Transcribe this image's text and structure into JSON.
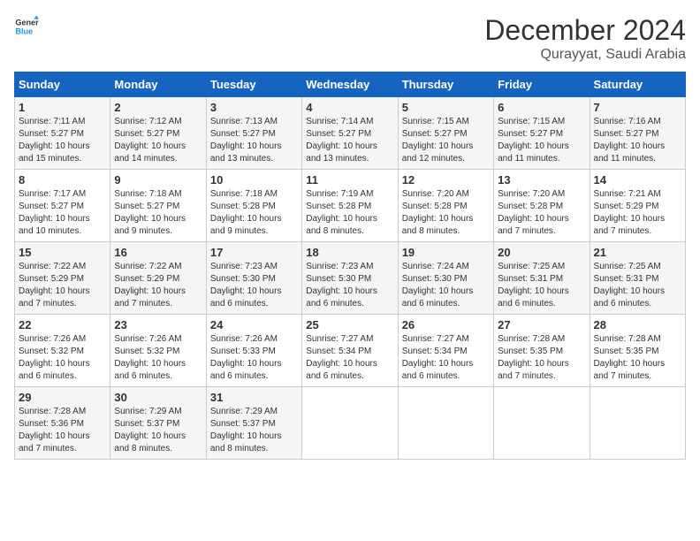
{
  "header": {
    "logo_line1": "General",
    "logo_line2": "Blue",
    "month": "December 2024",
    "location": "Qurayyat, Saudi Arabia"
  },
  "columns": [
    "Sunday",
    "Monday",
    "Tuesday",
    "Wednesday",
    "Thursday",
    "Friday",
    "Saturday"
  ],
  "weeks": [
    [
      {
        "day": "1",
        "sunrise": "7:11 AM",
        "sunset": "5:27 PM",
        "daylight": "10 hours and 15 minutes."
      },
      {
        "day": "2",
        "sunrise": "7:12 AM",
        "sunset": "5:27 PM",
        "daylight": "10 hours and 14 minutes."
      },
      {
        "day": "3",
        "sunrise": "7:13 AM",
        "sunset": "5:27 PM",
        "daylight": "10 hours and 13 minutes."
      },
      {
        "day": "4",
        "sunrise": "7:14 AM",
        "sunset": "5:27 PM",
        "daylight": "10 hours and 13 minutes."
      },
      {
        "day": "5",
        "sunrise": "7:15 AM",
        "sunset": "5:27 PM",
        "daylight": "10 hours and 12 minutes."
      },
      {
        "day": "6",
        "sunrise": "7:15 AM",
        "sunset": "5:27 PM",
        "daylight": "10 hours and 11 minutes."
      },
      {
        "day": "7",
        "sunrise": "7:16 AM",
        "sunset": "5:27 PM",
        "daylight": "10 hours and 11 minutes."
      }
    ],
    [
      {
        "day": "8",
        "sunrise": "7:17 AM",
        "sunset": "5:27 PM",
        "daylight": "10 hours and 10 minutes."
      },
      {
        "day": "9",
        "sunrise": "7:18 AM",
        "sunset": "5:27 PM",
        "daylight": "10 hours and 9 minutes."
      },
      {
        "day": "10",
        "sunrise": "7:18 AM",
        "sunset": "5:28 PM",
        "daylight": "10 hours and 9 minutes."
      },
      {
        "day": "11",
        "sunrise": "7:19 AM",
        "sunset": "5:28 PM",
        "daylight": "10 hours and 8 minutes."
      },
      {
        "day": "12",
        "sunrise": "7:20 AM",
        "sunset": "5:28 PM",
        "daylight": "10 hours and 8 minutes."
      },
      {
        "day": "13",
        "sunrise": "7:20 AM",
        "sunset": "5:28 PM",
        "daylight": "10 hours and 7 minutes."
      },
      {
        "day": "14",
        "sunrise": "7:21 AM",
        "sunset": "5:29 PM",
        "daylight": "10 hours and 7 minutes."
      }
    ],
    [
      {
        "day": "15",
        "sunrise": "7:22 AM",
        "sunset": "5:29 PM",
        "daylight": "10 hours and 7 minutes."
      },
      {
        "day": "16",
        "sunrise": "7:22 AM",
        "sunset": "5:29 PM",
        "daylight": "10 hours and 7 minutes."
      },
      {
        "day": "17",
        "sunrise": "7:23 AM",
        "sunset": "5:30 PM",
        "daylight": "10 hours and 6 minutes."
      },
      {
        "day": "18",
        "sunrise": "7:23 AM",
        "sunset": "5:30 PM",
        "daylight": "10 hours and 6 minutes."
      },
      {
        "day": "19",
        "sunrise": "7:24 AM",
        "sunset": "5:30 PM",
        "daylight": "10 hours and 6 minutes."
      },
      {
        "day": "20",
        "sunrise": "7:25 AM",
        "sunset": "5:31 PM",
        "daylight": "10 hours and 6 minutes."
      },
      {
        "day": "21",
        "sunrise": "7:25 AM",
        "sunset": "5:31 PM",
        "daylight": "10 hours and 6 minutes."
      }
    ],
    [
      {
        "day": "22",
        "sunrise": "7:26 AM",
        "sunset": "5:32 PM",
        "daylight": "10 hours and 6 minutes."
      },
      {
        "day": "23",
        "sunrise": "7:26 AM",
        "sunset": "5:32 PM",
        "daylight": "10 hours and 6 minutes."
      },
      {
        "day": "24",
        "sunrise": "7:26 AM",
        "sunset": "5:33 PM",
        "daylight": "10 hours and 6 minutes."
      },
      {
        "day": "25",
        "sunrise": "7:27 AM",
        "sunset": "5:34 PM",
        "daylight": "10 hours and 6 minutes."
      },
      {
        "day": "26",
        "sunrise": "7:27 AM",
        "sunset": "5:34 PM",
        "daylight": "10 hours and 6 minutes."
      },
      {
        "day": "27",
        "sunrise": "7:28 AM",
        "sunset": "5:35 PM",
        "daylight": "10 hours and 7 minutes."
      },
      {
        "day": "28",
        "sunrise": "7:28 AM",
        "sunset": "5:35 PM",
        "daylight": "10 hours and 7 minutes."
      }
    ],
    [
      {
        "day": "29",
        "sunrise": "7:28 AM",
        "sunset": "5:36 PM",
        "daylight": "10 hours and 7 minutes."
      },
      {
        "day": "30",
        "sunrise": "7:29 AM",
        "sunset": "5:37 PM",
        "daylight": "10 hours and 8 minutes."
      },
      {
        "day": "31",
        "sunrise": "7:29 AM",
        "sunset": "5:37 PM",
        "daylight": "10 hours and 8 minutes."
      },
      null,
      null,
      null,
      null
    ]
  ]
}
